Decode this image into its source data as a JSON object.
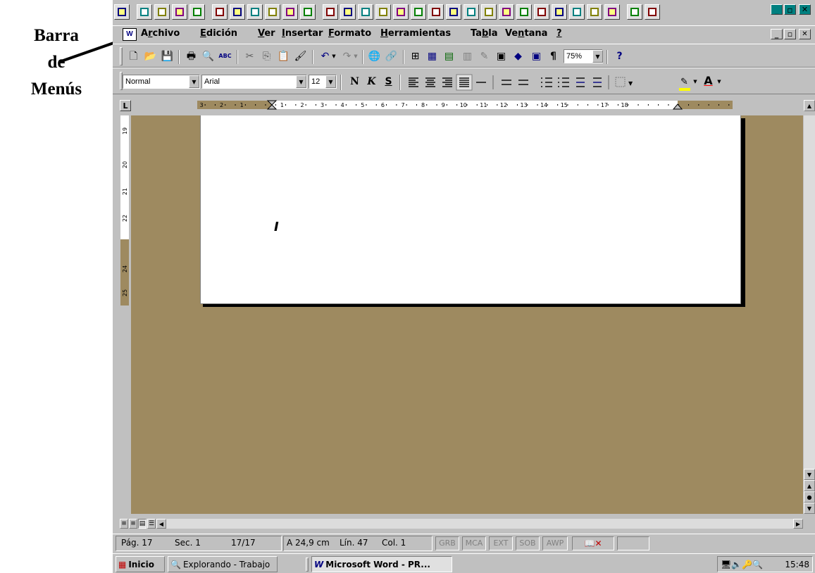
{
  "callout": {
    "line1": "Barra",
    "line2": "de",
    "line3": "Menús"
  },
  "office_bar": {
    "icons": [
      "word-icon",
      "office-icon",
      "toolbar-doc-icon",
      "toolbar-doc-icon",
      "toolbar-doc-icon",
      "word-icon",
      "excel-icon",
      "powerpoint-icon",
      "access-icon",
      "key-icon",
      "find-icon",
      "app-icon",
      "toolbar-doc-icon",
      "toolbar-doc-icon",
      "toolbar-doc-icon",
      "toolbar-doc-icon",
      "toolbar-doc-icon",
      "toolbar-doc-icon",
      "toolbar-doc-icon",
      "toolbar-doc-icon",
      "toolbar-doc-icon",
      "toolbar-doc-icon",
      "toolbar-doc-icon",
      "toolbar-doc-icon",
      "toolbar-doc-icon",
      "toolbar-doc-icon",
      "toolbar-doc-icon",
      "toolbar-doc-icon",
      "toolbar-doc-icon",
      "toolbar-doc-icon"
    ]
  },
  "window_controls": {
    "minimize": "_",
    "maximize": "▫",
    "close": "✕"
  },
  "menu": {
    "items": [
      {
        "prefix": "A",
        "key": "r",
        "rest": "chivo"
      },
      {
        "prefix": "",
        "key": "E",
        "rest": "dición"
      },
      {
        "prefix": "",
        "key": "V",
        "rest": "er"
      },
      {
        "prefix": "",
        "key": "I",
        "rest": "nsertar"
      },
      {
        "prefix": "",
        "key": "F",
        "rest": "ormato"
      },
      {
        "prefix": "",
        "key": "H",
        "rest": "erramientas"
      },
      {
        "prefix": "Ta",
        "key": "b",
        "rest": "la"
      },
      {
        "prefix": "Ve",
        "key": "n",
        "rest": "tana"
      },
      {
        "prefix": "",
        "key": "?",
        "rest": ""
      }
    ]
  },
  "toolbar_std": {
    "new": "🗋",
    "open": "📂",
    "save": "💾",
    "print": "🖶",
    "preview": "🔍",
    "spell": "ABC",
    "cut": "✂",
    "copy": "⎘",
    "paste": "📋",
    "format_painter": "🖌",
    "undo": "↶",
    "redo": "↷",
    "web": "🌐",
    "hyperlink": "🔗",
    "tables_borders": "⊞",
    "insert_table": "▦",
    "insert_excel": "▤",
    "columns": "▥",
    "drawing": "✎",
    "doc_map": "▣",
    "show_hide": "¶",
    "zoom": "75%",
    "help": "?"
  },
  "toolbar_fmt": {
    "style": "Normal",
    "font": "Arial",
    "size": "12",
    "bold": "N",
    "italic": "K",
    "underline": "S",
    "highlight": "✎",
    "font_color": "A"
  },
  "ruler": {
    "tab": "L",
    "numbers": [
      "3",
      "2",
      "1",
      "1",
      "2",
      "3",
      "4",
      "5",
      "6",
      "7",
      "8",
      "9",
      "10",
      "11",
      "12",
      "13",
      "14",
      "15",
      "17",
      "18"
    ],
    "v_numbers": [
      "19",
      "20",
      "21",
      "22",
      "24",
      "25"
    ]
  },
  "status": {
    "page": "Pág. 17",
    "section": "Sec. 1",
    "pages": "17/17",
    "at": "A 24,9 cm",
    "line": "Lín. 47",
    "col": "Col. 1",
    "grb": "GRB",
    "mca": "MCA",
    "ext": "EXT",
    "sob": "SOB",
    "awp": "AWP"
  },
  "taskbar": {
    "start": "Inicio",
    "tasks": [
      "Explorando - Trabajo",
      "Microsoft Word - PR..."
    ],
    "clock": "15:48"
  },
  "colors": {
    "workspace": "#9e8a60",
    "title_active": "#000080",
    "toolbar": "#c0c0c0"
  }
}
